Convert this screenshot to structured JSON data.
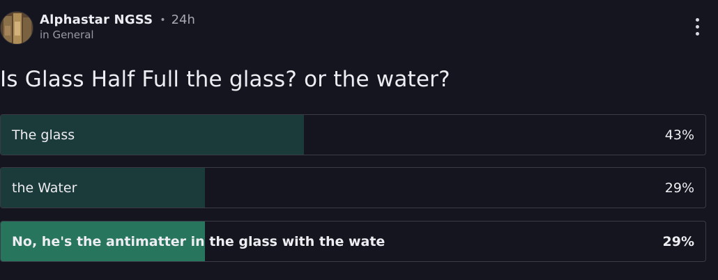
{
  "post": {
    "author": "Alphastar NGSS",
    "separator": "•",
    "time": "24h",
    "channel": "in General",
    "menu_icon": "more-vertical-icon",
    "avatar_icon": "user-avatar-image"
  },
  "poll": {
    "question": "Is Glass Half Full the glass? or the water?",
    "options": [
      {
        "label": "The glass",
        "percent": "43%",
        "fraction": 0.43,
        "selected": false
      },
      {
        "label": "the Water",
        "percent": "29%",
        "fraction": 0.29,
        "selected": false
      },
      {
        "label": "No, he's the antimatter in the glass with the wate",
        "percent": "29%",
        "fraction": 0.29,
        "selected": true
      }
    ]
  },
  "colors": {
    "background": "#15151f",
    "bar_fill": "#1b3a3a",
    "bar_fill_selected": "#26755c",
    "option_border": "#3a3b47"
  }
}
